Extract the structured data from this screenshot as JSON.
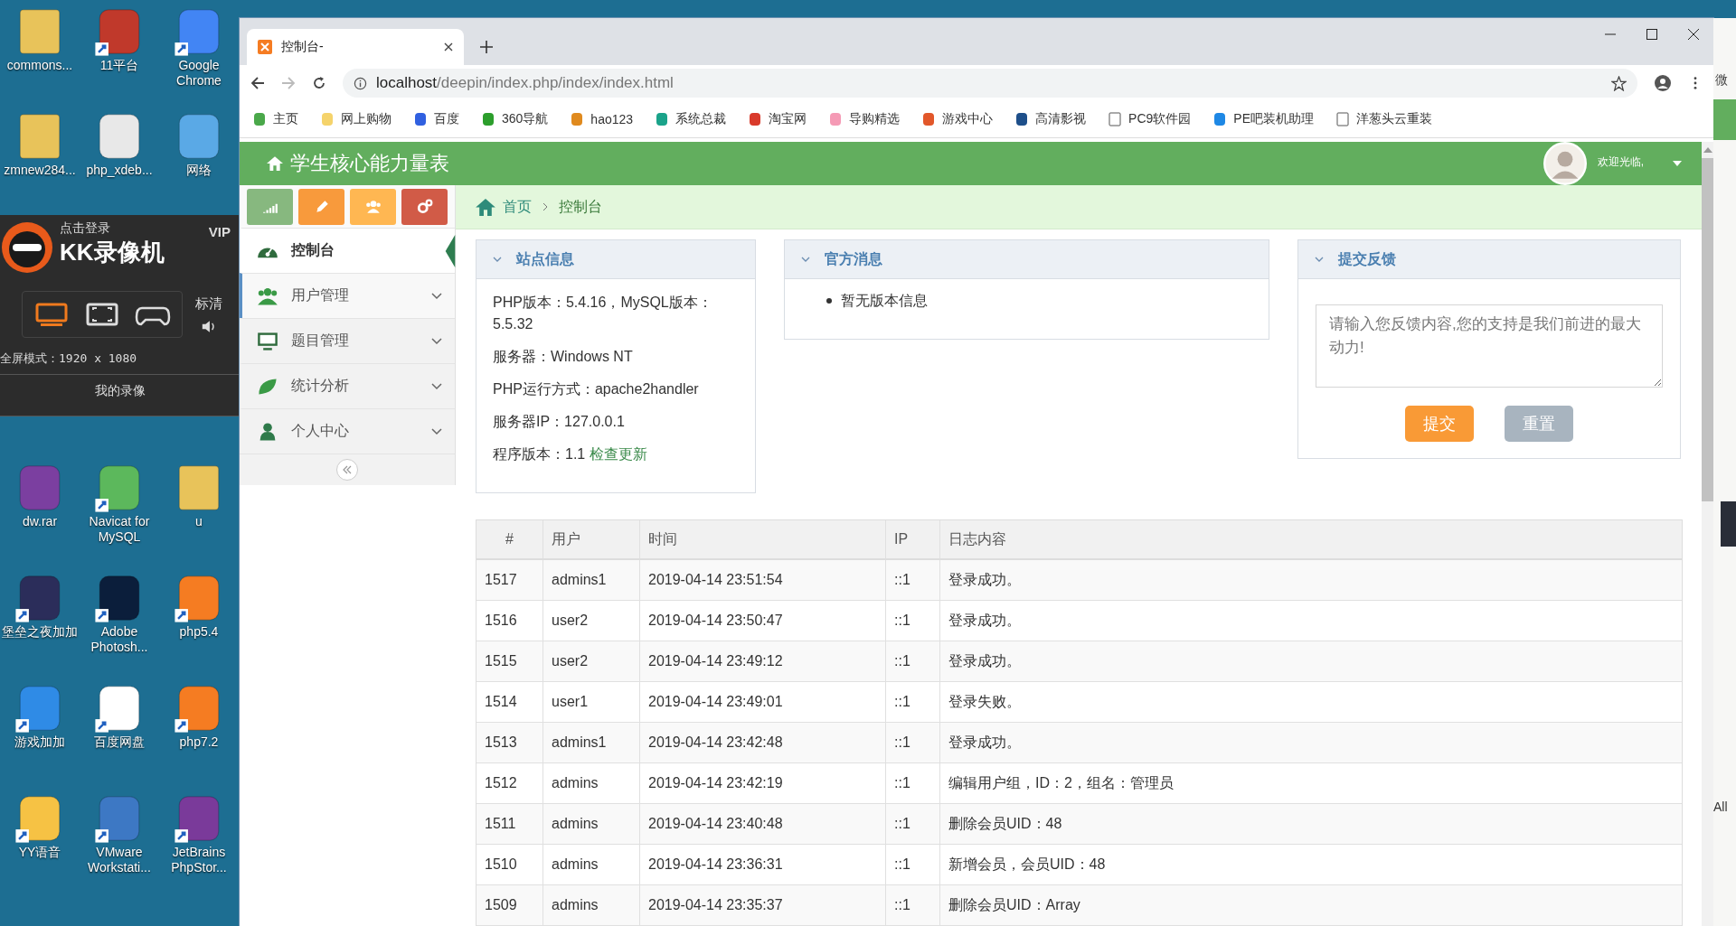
{
  "desktop": {
    "icons_top": [
      {
        "label": "commons...",
        "kind": "folder",
        "shortcut": false
      },
      {
        "label": "11平台",
        "kind": "game",
        "shortcut": true
      },
      {
        "label": "Google Chrome",
        "kind": "browser",
        "shortcut": true
      },
      {
        "label": "zmnew284...",
        "kind": "folder",
        "shortcut": false
      },
      {
        "label": "php_xdeb...",
        "kind": "file",
        "shortcut": false
      },
      {
        "label": "网络",
        "kind": "network",
        "shortcut": false
      }
    ],
    "recorder": {
      "login": "点击登录",
      "title": "KK录像机",
      "vip": "VIP",
      "quality": "标清",
      "mode": "全屏模式：1920 x 1080",
      "recordings": "我的录像",
      "modes": [
        {
          "kind": "screen",
          "selected": true
        },
        {
          "kind": "region",
          "selected": false
        },
        {
          "kind": "game",
          "selected": false
        }
      ]
    },
    "icons_bottom": [
      {
        "label": "dw.rar",
        "kind": "archive",
        "shortcut": false
      },
      {
        "label": "Navicat for MySQL",
        "kind": "leaf",
        "shortcut": true
      },
      {
        "label": "u",
        "kind": "folder",
        "shortcut": false
      },
      {
        "label": "堡垒之夜加加",
        "kind": "dark",
        "shortcut": true
      },
      {
        "label": "Adobe Photosh...",
        "kind": "ps",
        "shortcut": true
      },
      {
        "label": "php5.4",
        "kind": "xampp",
        "shortcut": true
      },
      {
        "label": "游戏加加",
        "kind": "gplus",
        "shortcut": true
      },
      {
        "label": "百度网盘",
        "kind": "cloud",
        "shortcut": true
      },
      {
        "label": "php7.2",
        "kind": "xampp",
        "shortcut": true
      },
      {
        "label": "YY语音",
        "kind": "yy",
        "shortcut": true
      },
      {
        "label": "VMware Workstati...",
        "kind": "vm",
        "shortcut": true
      },
      {
        "label": "JetBrains PhpStor...",
        "kind": "jb",
        "shortcut": true
      }
    ]
  },
  "background_window": {
    "texts": [
      "微",
      "All"
    ]
  },
  "browser": {
    "tab": {
      "title": "控制台-"
    },
    "url_host": "localhost",
    "url_path": "/deepin/index.php/index/index.html",
    "bookmarks": [
      {
        "label": "主页",
        "kind": "home"
      },
      {
        "label": "网上购物",
        "kind": "folder"
      },
      {
        "label": "百度",
        "kind": "paw"
      },
      {
        "label": "360导航",
        "kind": "ball"
      },
      {
        "label": "hao123",
        "kind": "sprout"
      },
      {
        "label": "系统总裁",
        "kind": "swirl"
      },
      {
        "label": "淘宝网",
        "kind": "red"
      },
      {
        "label": "导购精选",
        "kind": "bag"
      },
      {
        "label": "游戏中心",
        "kind": "pin"
      },
      {
        "label": "高清影视",
        "kind": "film"
      },
      {
        "label": "PC9软件园",
        "kind": "page"
      },
      {
        "label": "PE吧装机助理",
        "kind": "pe"
      },
      {
        "label": "洋葱头云重装",
        "kind": "page"
      }
    ]
  },
  "app": {
    "title": "学生核心能力量表",
    "welcome": "欢迎光临,",
    "shortcuts": [
      {
        "kind": "signal",
        "color": "#87b87f"
      },
      {
        "kind": "pencil",
        "color": "#f89a3c"
      },
      {
        "kind": "users",
        "color": "#ffb752"
      },
      {
        "kind": "cogs",
        "color": "#d15b47"
      }
    ],
    "nav": [
      {
        "label": "控制台",
        "kind": "dashboard",
        "selected": true,
        "hovered": false,
        "expandable": false
      },
      {
        "label": "用户管理",
        "kind": "users",
        "selected": false,
        "hovered": true,
        "expandable": true
      },
      {
        "label": "题目管理",
        "kind": "monitor",
        "selected": false,
        "hovered": false,
        "expandable": true
      },
      {
        "label": "统计分析",
        "kind": "leaf",
        "selected": false,
        "hovered": false,
        "expandable": true
      },
      {
        "label": "个人中心",
        "kind": "user",
        "selected": false,
        "hovered": false,
        "expandable": true
      }
    ],
    "breadcrumb": [
      "首页",
      "控制台"
    ],
    "site_info": {
      "title": "站点信息",
      "lines": [
        {
          "text": "PHP版本：5.4.16，MySQL版本：5.5.32"
        },
        {
          "text": "服务器：Windows NT"
        },
        {
          "text": "PHP运行方式：apache2handler"
        },
        {
          "text": "服务器IP：127.0.0.1"
        },
        {
          "text": "程序版本：1.1",
          "link": "检查更新"
        }
      ]
    },
    "news": {
      "title": "官方消息",
      "items": [
        "暂无版本信息"
      ]
    },
    "feedback": {
      "title": "提交反馈",
      "placeholder": "请输入您反馈内容,您的支持是我们前进的最大动力!",
      "submit": "提交",
      "reset": "重置"
    },
    "table": {
      "columns": [
        "#",
        "用户",
        "时间",
        "IP",
        "日志内容"
      ],
      "rows": [
        [
          "1517",
          "admins1",
          "2019-04-14 23:51:54",
          "::1",
          "登录成功。"
        ],
        [
          "1516",
          "user2",
          "2019-04-14 23:50:47",
          "::1",
          "登录成功。"
        ],
        [
          "1515",
          "user2",
          "2019-04-14 23:49:12",
          "::1",
          "登录成功。"
        ],
        [
          "1514",
          "user1",
          "2019-04-14 23:49:01",
          "::1",
          "登录失败。"
        ],
        [
          "1513",
          "admins1",
          "2019-04-14 23:42:48",
          "::1",
          "登录成功。"
        ],
        [
          "1512",
          "admins",
          "2019-04-14 23:42:19",
          "::1",
          "编辑用户组，ID：2，组名：管理员"
        ],
        [
          "1511",
          "admins",
          "2019-04-14 23:40:48",
          "::1",
          "删除会员UID：48"
        ],
        [
          "1510",
          "admins",
          "2019-04-14 23:36:31",
          "::1",
          "新增会员，会员UID：48"
        ],
        [
          "1509",
          "admins",
          "2019-04-14 23:35:37",
          "::1",
          "删除会员UID：Array"
        ]
      ]
    }
  }
}
